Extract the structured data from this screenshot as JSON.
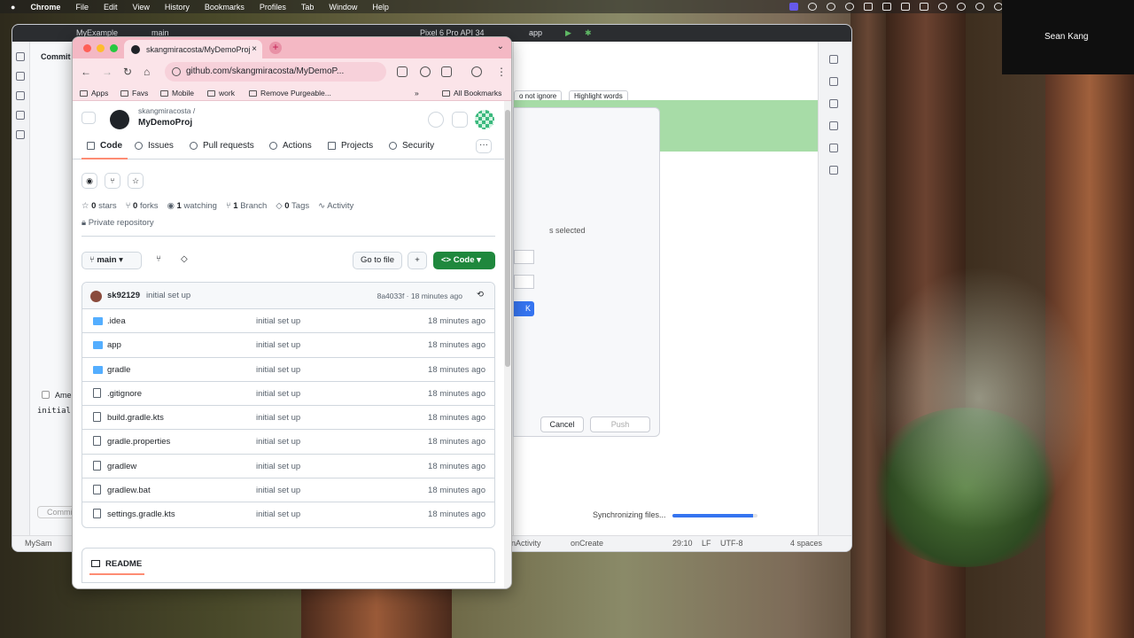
{
  "menubar": {
    "apple": "",
    "items": [
      "Chrome",
      "File",
      "Edit",
      "View",
      "History",
      "Bookmarks",
      "Profiles",
      "Tab",
      "Window",
      "Help"
    ]
  },
  "zoom": {
    "participant": "Sean Kang"
  },
  "android_studio": {
    "project": "MyExample",
    "branch": "main",
    "device": "Pixel 6 Pro API 34",
    "run_config": "app",
    "commit_panel_title": "Commit",
    "amend_label": "Ame",
    "commit_msg": "initial",
    "commit_btn": "Commi",
    "ignore_chip": "o not ignore",
    "highlight_chip": "Highlight words",
    "selected_text": "s selected",
    "ok_btn": "K",
    "cancel_btn": "Cancel",
    "push_btn": "Push",
    "sync_text": "Synchronizing files...",
    "sync_progress": 0.95,
    "status_left": "MyExample",
    "status_left2": "MySam",
    "crumb1": "nActivity",
    "crumb2": "onCreate",
    "cursor": "29:10",
    "line_sep": "LF",
    "encoding": "UTF-8",
    "indent": "4 spaces"
  },
  "chrome": {
    "tab_title": "skangmiracosta/MyDemoProj",
    "url": "github.com/skangmiracosta/MyDemoP...",
    "bookmarks": [
      "Apps",
      "Favs",
      "Mobile",
      "work",
      "Remove Purgeable..."
    ],
    "all_bookmarks": "All Bookmarks"
  },
  "repo": {
    "owner": "skangmiracosta /",
    "name": "MyDemoProj",
    "tabs": [
      "Code",
      "Issues",
      "Pull requests",
      "Actions",
      "Projects",
      "Security"
    ],
    "stats": {
      "stars": "0",
      "stars_label": "stars",
      "forks": "0",
      "forks_label": "forks",
      "watching": "1",
      "watching_label": "watching",
      "branches": "1",
      "branches_label": "Branch",
      "tags": "0",
      "tags_label": "Tags",
      "activity": "Activity"
    },
    "visibility": "Private repository",
    "branch": "main",
    "goto_file": "Go to file",
    "add": "+",
    "code_btn": "Code",
    "last_commit": {
      "author": "sk92129",
      "message": "initial set up",
      "hash": "8a4033f · 18 minutes ago"
    },
    "files": [
      {
        "name": ".idea",
        "type": "dir",
        "msg": "initial set up",
        "age": "18 minutes ago"
      },
      {
        "name": "app",
        "type": "dir",
        "msg": "initial set up",
        "age": "18 minutes ago"
      },
      {
        "name": "gradle",
        "type": "dir",
        "msg": "initial set up",
        "age": "18 minutes ago"
      },
      {
        "name": ".gitignore",
        "type": "file",
        "msg": "initial set up",
        "age": "18 minutes ago"
      },
      {
        "name": "build.gradle.kts",
        "type": "file",
        "msg": "initial set up",
        "age": "18 minutes ago"
      },
      {
        "name": "gradle.properties",
        "type": "file",
        "msg": "initial set up",
        "age": "18 minutes ago"
      },
      {
        "name": "gradlew",
        "type": "file",
        "msg": "initial set up",
        "age": "18 minutes ago"
      },
      {
        "name": "gradlew.bat",
        "type": "file",
        "msg": "initial set up",
        "age": "18 minutes ago"
      },
      {
        "name": "settings.gradle.kts",
        "type": "file",
        "msg": "initial set up",
        "age": "18 minutes ago"
      }
    ],
    "readme": "README"
  },
  "colors": {
    "accent": "#1f883d",
    "tab_pink": "#f4b8c4",
    "studio_blue": "#3574f0"
  }
}
